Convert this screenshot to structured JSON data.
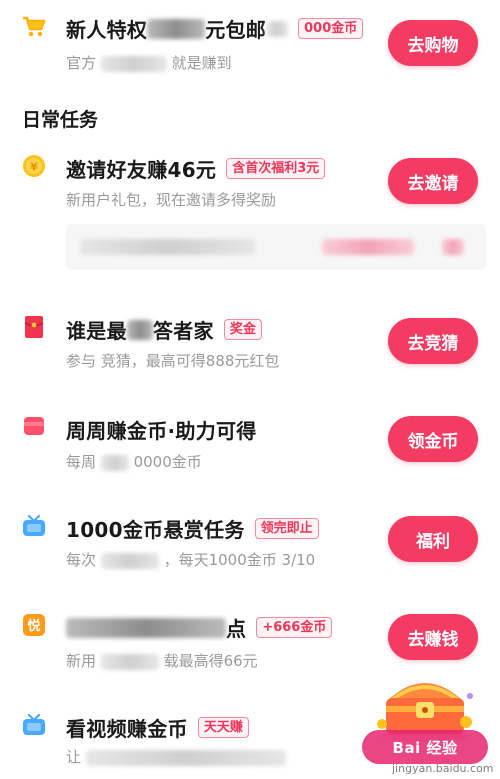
{
  "section_heading": "日常任务",
  "tasks": [
    {
      "title": "新人特权",
      "title_tail": "元包邮",
      "tag": "000金币",
      "subtitle": "官方",
      "subtitle_tail": "就是赚到",
      "button": "去购物"
    },
    {
      "title": "邀请好友赚46元",
      "tag": "含首次福利3元",
      "subtitle": "新用户礼包，现在邀请多得奖励",
      "button": "去邀请"
    },
    {
      "title": "谁是最",
      "title_tail": "答者家",
      "tag": "奖金",
      "subtitle": "参与",
      "subtitle_tail": "竞猜，最高可得888元红包",
      "button": "去竞猜"
    },
    {
      "title": "周周赚金币·助力可得",
      "subtitle": "每周",
      "subtitle_tail": "0000金币",
      "button": "领金币"
    },
    {
      "title": "1000金币悬赏任务",
      "tag": "领完即止",
      "subtitle": "每次",
      "subtitle_tail": "，每天1000金币 3/10",
      "button": "福利"
    },
    {
      "title_tail": "点",
      "tag": "+666金币",
      "subtitle": "新用",
      "subtitle_tail": "载最高得66元",
      "button": "去赚钱"
    },
    {
      "title": "看视频赚金币",
      "tag": "天天赚",
      "subtitle": "让"
    }
  ],
  "watermark": {
    "text": "Bai 经验",
    "sub": "jingyan.baidu.com"
  },
  "colors": {
    "accent": "#f43b62",
    "tag_text": "#f0365a",
    "subtitle": "#9a9a9a"
  }
}
